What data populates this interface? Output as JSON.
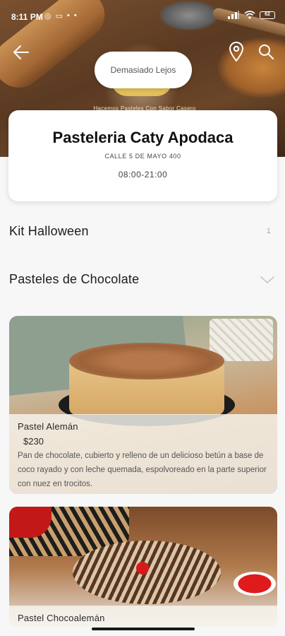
{
  "status_bar": {
    "time": "8:11 PM",
    "battery": "62"
  },
  "header": {
    "distance_label": "Demasiado Lejos",
    "logo_tagline": "Hacemos Pasteles Con Sabor Casero"
  },
  "store": {
    "name": "Pasteleria Caty Apodaca",
    "address": "CALLE 5 DE MAYO 400",
    "hours": "08:00-21:00"
  },
  "categories": [
    {
      "label": "Kit Halloween",
      "count": "1"
    },
    {
      "label": "Pasteles de Chocolate",
      "count": ""
    }
  ],
  "products": [
    {
      "name": "Pastel Alemán",
      "price": "$230",
      "description": "Pan de chocolate, cubierto y relleno de un delicioso betún a base de coco rayado y con leche quemada, espolvoreado en la parte superior con nuez en trocitos."
    },
    {
      "name": "Pastel Chocoalemán",
      "price": "",
      "description": ""
    }
  ],
  "colors": {
    "card_bg": "#ffffff",
    "page_bg": "#f7f7f7",
    "text_primary": "#1c1c1c"
  }
}
